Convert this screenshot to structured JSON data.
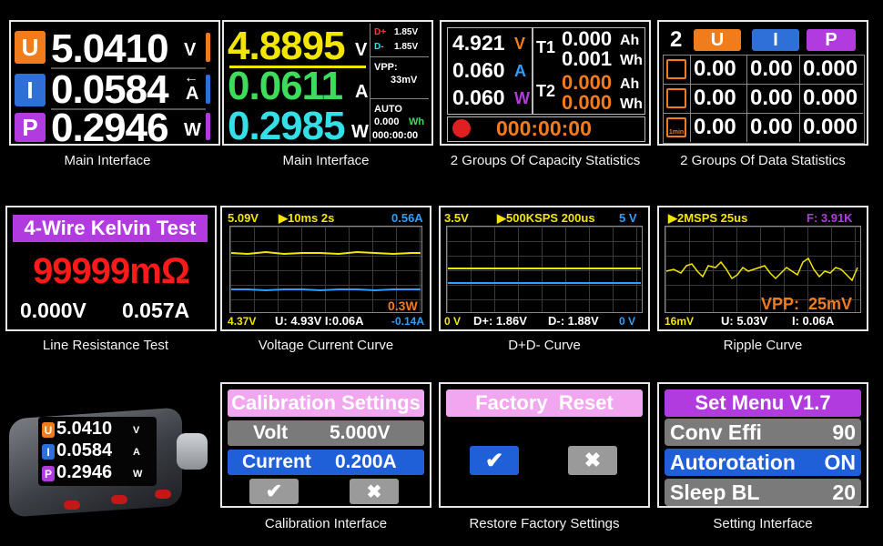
{
  "main1": {
    "u_label": "U",
    "u_value": "5.0410",
    "u_unit": "V",
    "i_label": "I",
    "i_value": "0.0584",
    "i_unit": "A",
    "arrow": "←",
    "p_label": "P",
    "p_value": "0.2946",
    "p_unit": "W",
    "caption": "Main Interface"
  },
  "main2": {
    "v_value": "4.8895",
    "v_unit": "V",
    "a_value": "0.0611",
    "a_unit": "A",
    "w_value": "0.2985",
    "w_unit": "W",
    "dplus_label": "D+",
    "dplus_value": "1.85V",
    "dminus_label": "D-",
    "dminus_value": "1.85V",
    "vpp_label": "VPP:",
    "vpp_value": "33mV",
    "auto": "AUTO",
    "wh": "0.000",
    "wh_unit": "Wh",
    "time": "000:00:00",
    "caption": "Main Interface"
  },
  "capacity": {
    "v": "4.921",
    "v_unit": "V",
    "a": "0.060",
    "a_unit": "A",
    "w": "0.060",
    "w_unit": "W",
    "t1": "T1",
    "t1_ah": "0.000",
    "t1_ah_unit": "Ah",
    "t1_wh": "0.001",
    "t1_wh_unit": "Wh",
    "t2": "T2",
    "t2_ah": "0.000",
    "t2_ah_unit": "Ah",
    "t2_wh": "0.000",
    "t2_wh_unit": "Wh",
    "timer": "000:00:00",
    "caption": "2 Groups Of Capacity Statistics"
  },
  "datastats": {
    "n": "2",
    "h_u": "U",
    "h_i": "I",
    "h_p": "P",
    "rows": [
      [
        "0.00",
        "0.00",
        "0.000"
      ],
      [
        "0.00",
        "0.00",
        "0.000"
      ],
      [
        "0.00",
        "0.00",
        "0.000"
      ]
    ],
    "icon3_label": "1min",
    "caption": "2 Groups Of Data Statistics"
  },
  "kelvin": {
    "title": "4-Wire Kelvin Test",
    "ohm": "99999mΩ",
    "v": "0.000V",
    "a": "0.057A",
    "caption": "Line Resistance Test"
  },
  "vcurve": {
    "top_left": "5.09V",
    "top_mid": "▶10ms 2s",
    "top_right": "0.56A",
    "power": "0.3W",
    "bot_left": "4.37V",
    "bot_mid": "U: 4.93V I:0.06A",
    "bot_right": "-0.14A",
    "caption": "Voltage Current Curve"
  },
  "dcurve": {
    "top_left": "3.5V",
    "top_mid": "▶500KSPS  200us",
    "top_right": "5 V",
    "bot_left": "0 V",
    "bot_dp": "D+: 1.86V",
    "bot_dm": "D-: 1.88V",
    "bot_right": "0 V",
    "caption": "D+D- Curve"
  },
  "ripple": {
    "top_left": "▶2MSPS  25us",
    "top_right": "F: 3.91K",
    "vpp": "VPP:  25mV",
    "bot_left": "16mV",
    "bot_mid": "U: 5.03V",
    "bot_right": "I: 0.06A",
    "caption": "Ripple Curve"
  },
  "device": {
    "u": "5.0410",
    "i": "0.0584",
    "p": "0.2946",
    "u_label": "U",
    "i_label": "I",
    "p_label": "P",
    "u_unit": "V",
    "i_unit": "A",
    "p_unit": "W"
  },
  "calib": {
    "title": "Calibration Settings",
    "volt_label": "Volt",
    "volt_value": "5.000V",
    "current_label": "Current",
    "current_value": "0.200A",
    "ok": "✔",
    "no": "✖",
    "caption": "Calibration Interface"
  },
  "factory": {
    "title": "Factory  Reset",
    "ok": "✔",
    "no": "✖",
    "caption": "Restore Factory Settings"
  },
  "setmenu": {
    "title": "Set Menu V1.7",
    "items": [
      {
        "label": "Conv Effi",
        "value": "90"
      },
      {
        "label": "Autorotation",
        "value": "ON"
      },
      {
        "label": "Sleep BL",
        "value": "20"
      }
    ],
    "caption": "Setting Interface"
  },
  "colors": {
    "orange": "#f07c1c",
    "blue": "#2e6fd8",
    "purple": "#b23be0",
    "yellow": "#f2e600",
    "green": "#3ddc5a",
    "cyan": "#34e0e8",
    "pink": "#f3a6f0",
    "menu_blue": "#1f5fd8"
  }
}
